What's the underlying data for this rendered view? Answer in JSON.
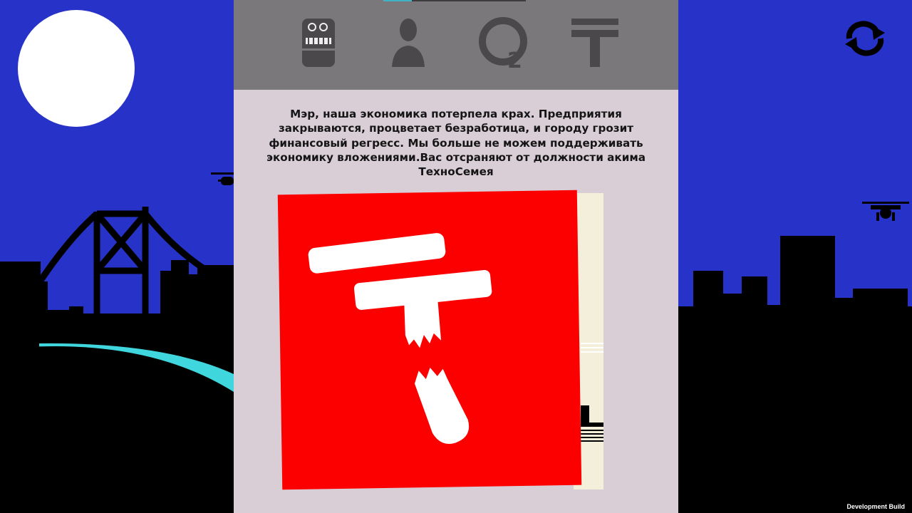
{
  "topbar": {
    "progress": 0.2,
    "stats": [
      {
        "name": "technology",
        "icon": "robot-icon"
      },
      {
        "name": "people",
        "icon": "person-icon"
      },
      {
        "name": "ecology",
        "icon": "o2-icon"
      },
      {
        "name": "money",
        "icon": "tenge-icon"
      }
    ]
  },
  "message": "Мэр, наша экономика потерпела крах. Предприятия закрываются, процветает безработица, и городу грозит финансовый регресс. Мы больше не можем поддерживать экономику вложениями.Вас отсраняют от должности акима ТехноСемея",
  "card": {
    "icon": "broken-tenge-icon",
    "background_color": "#fc0000"
  },
  "scene": {
    "sky_color": "#2732c9",
    "moon_color": "#ffffff",
    "river_color": "#3fd6dd",
    "restart_icon": "restart-icon"
  },
  "footer": {
    "dev_build_label": "Development Build"
  }
}
